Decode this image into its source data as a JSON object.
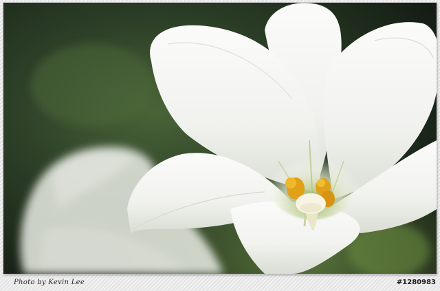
{
  "photo": {
    "subject": "white-lily-flower-icon",
    "colors": {
      "background_dark": "#1f2e1d",
      "background_green": "#3e5a32",
      "petal_white": "#f7f7f5",
      "petal_shadow": "#d6dbd0",
      "throat_green": "#b8c98a",
      "anther_yellow": "#e3a51a",
      "stigma": "#f4f0dc"
    }
  },
  "footer": {
    "credit": "Photo by Kevin Lee",
    "photo_id": "#1280983"
  }
}
